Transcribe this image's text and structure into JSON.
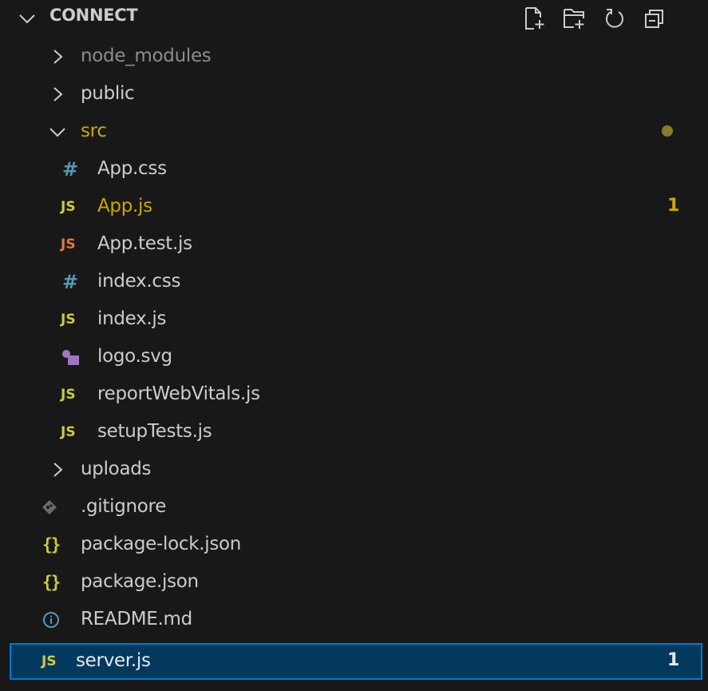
{
  "explorer": {
    "title": "CONNECT",
    "actions": [
      {
        "name": "new-file-icon"
      },
      {
        "name": "new-folder-icon"
      },
      {
        "name": "refresh-icon"
      },
      {
        "name": "collapse-folders-icon"
      }
    ]
  },
  "tree": [
    {
      "label": "node_modules",
      "kind": "folder",
      "expanded": false
    },
    {
      "label": "public",
      "kind": "folder",
      "expanded": false
    },
    {
      "label": "src",
      "kind": "folder",
      "expanded": true
    },
    {
      "label": "App.css",
      "kind": "file",
      "icon": "#"
    },
    {
      "label": "App.js",
      "kind": "file",
      "icon": "JS",
      "badge": "1"
    },
    {
      "label": "App.test.js",
      "kind": "file",
      "icon": "JS"
    },
    {
      "label": "index.css",
      "kind": "file",
      "icon": "#"
    },
    {
      "label": "index.js",
      "kind": "file",
      "icon": "JS"
    },
    {
      "label": "logo.svg",
      "kind": "file",
      "icon": "svg-icon"
    },
    {
      "label": "reportWebVitals.js",
      "kind": "file",
      "icon": "JS"
    },
    {
      "label": "setupTests.js",
      "kind": "file",
      "icon": "JS"
    },
    {
      "label": "uploads",
      "kind": "folder",
      "expanded": false
    },
    {
      "label": ".gitignore",
      "kind": "file",
      "icon": "git-icon"
    },
    {
      "label": "package-lock.json",
      "kind": "file",
      "icon": "{}"
    },
    {
      "label": "package.json",
      "kind": "file",
      "icon": "{}"
    },
    {
      "label": "README.md",
      "kind": "file",
      "icon": "info-icon"
    },
    {
      "label": "server.js",
      "kind": "file",
      "icon": "JS",
      "badge": "1",
      "selected": true
    }
  ],
  "colors": {
    "background": "#181818",
    "text": "#cccccc",
    "dimmed": "#8c8c8c",
    "warning": "#cca700",
    "modified_dot": "#8a7a2e",
    "js_yellow": "#cbcb41",
    "test_js_orange": "#e37933",
    "css_blue": "#519aba",
    "svg_purple": "#a074c4",
    "selection_bg": "#04395e",
    "selection_border": "#0078d4"
  }
}
